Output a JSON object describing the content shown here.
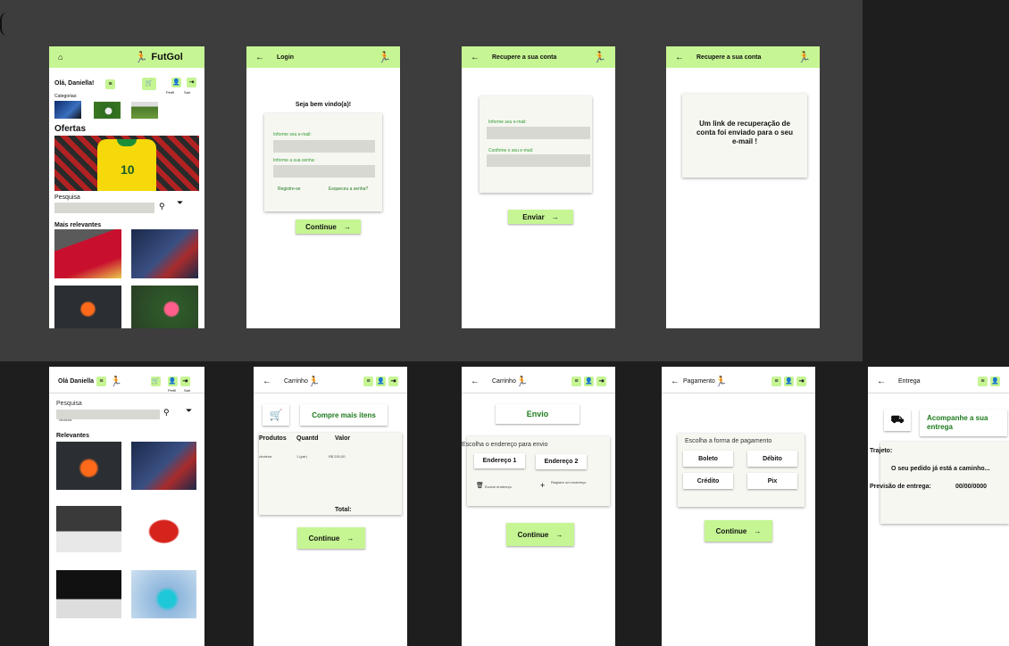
{
  "home": {
    "brand": "FutGol",
    "greeting": "Olá, Daniella!",
    "categories_label": "Categorias:",
    "profile_label": "Perfil",
    "exit_label": "Sair",
    "offers_title": "Ofertas",
    "search_label": "Pesquisa",
    "relevant_title": "Mais relevantes"
  },
  "login": {
    "title": "Login",
    "welcome": "Seja bem vindo(a)!",
    "email_label": "Informe seu e-mail:",
    "password_label": "Informe a sua senha:",
    "register_link": "Registre-se",
    "forgot_link": "Esqueceu a senha?",
    "continue_label": "Continue"
  },
  "recover": {
    "title": "Recupere a sua conta",
    "email_label": "Informe seu e-mail:",
    "confirm_label": "Confirme o seu e-mail:",
    "send_label": "Enviar"
  },
  "recover_done": {
    "title": "Recupere a sua conta",
    "message": "Um link de recuperação de conta foi enviado para o seu e-mail !"
  },
  "search": {
    "greeting": "Olá Daniella",
    "search_label": "Pesquisa",
    "search_value": "chuteira",
    "relevant_title": "Relevantes",
    "profile_label": "Perfil",
    "exit_label": "Sair"
  },
  "cart": {
    "title": "Carrinho",
    "buy_more": "Compre mais itens",
    "col_products": "Produtos",
    "col_qty": "Quantd",
    "col_value": "Valor",
    "row_product": "chuteira",
    "row_qty": "1 (par)",
    "row_value": "R$ 200,00",
    "total_label": "Total:",
    "continue_label": "Continue"
  },
  "shipping": {
    "title": "Carrinho",
    "heading": "Envio",
    "choose_label": "Escolha o endereço para envio",
    "address1": "Endereço 1",
    "address2": "Endereço 2",
    "delete_label": "Excluir endereço",
    "register_label": "Registre um endereço",
    "continue_label": "Continue"
  },
  "payment": {
    "title": "Pagamento",
    "choose_label": "Escolha a forma de pagamento",
    "boleto": "Boleto",
    "debito": "Débito",
    "credito": "Crédito",
    "pix": "Pix",
    "continue_label": "Continue"
  },
  "delivery": {
    "title": "Entrega",
    "track_label": "Acompanhe a sua entrega",
    "route_label": "Trajeto:",
    "route_status": "O seu pedido já está a caminho...",
    "forecast_label": "Previsão de entrega:",
    "forecast_value": "00/00/0000"
  },
  "colors": {
    "accent": "#c6f593",
    "green_text": "#2e9b2e",
    "bg_dark": "#1e1e1e",
    "bg_band": "#3d3d3d"
  }
}
